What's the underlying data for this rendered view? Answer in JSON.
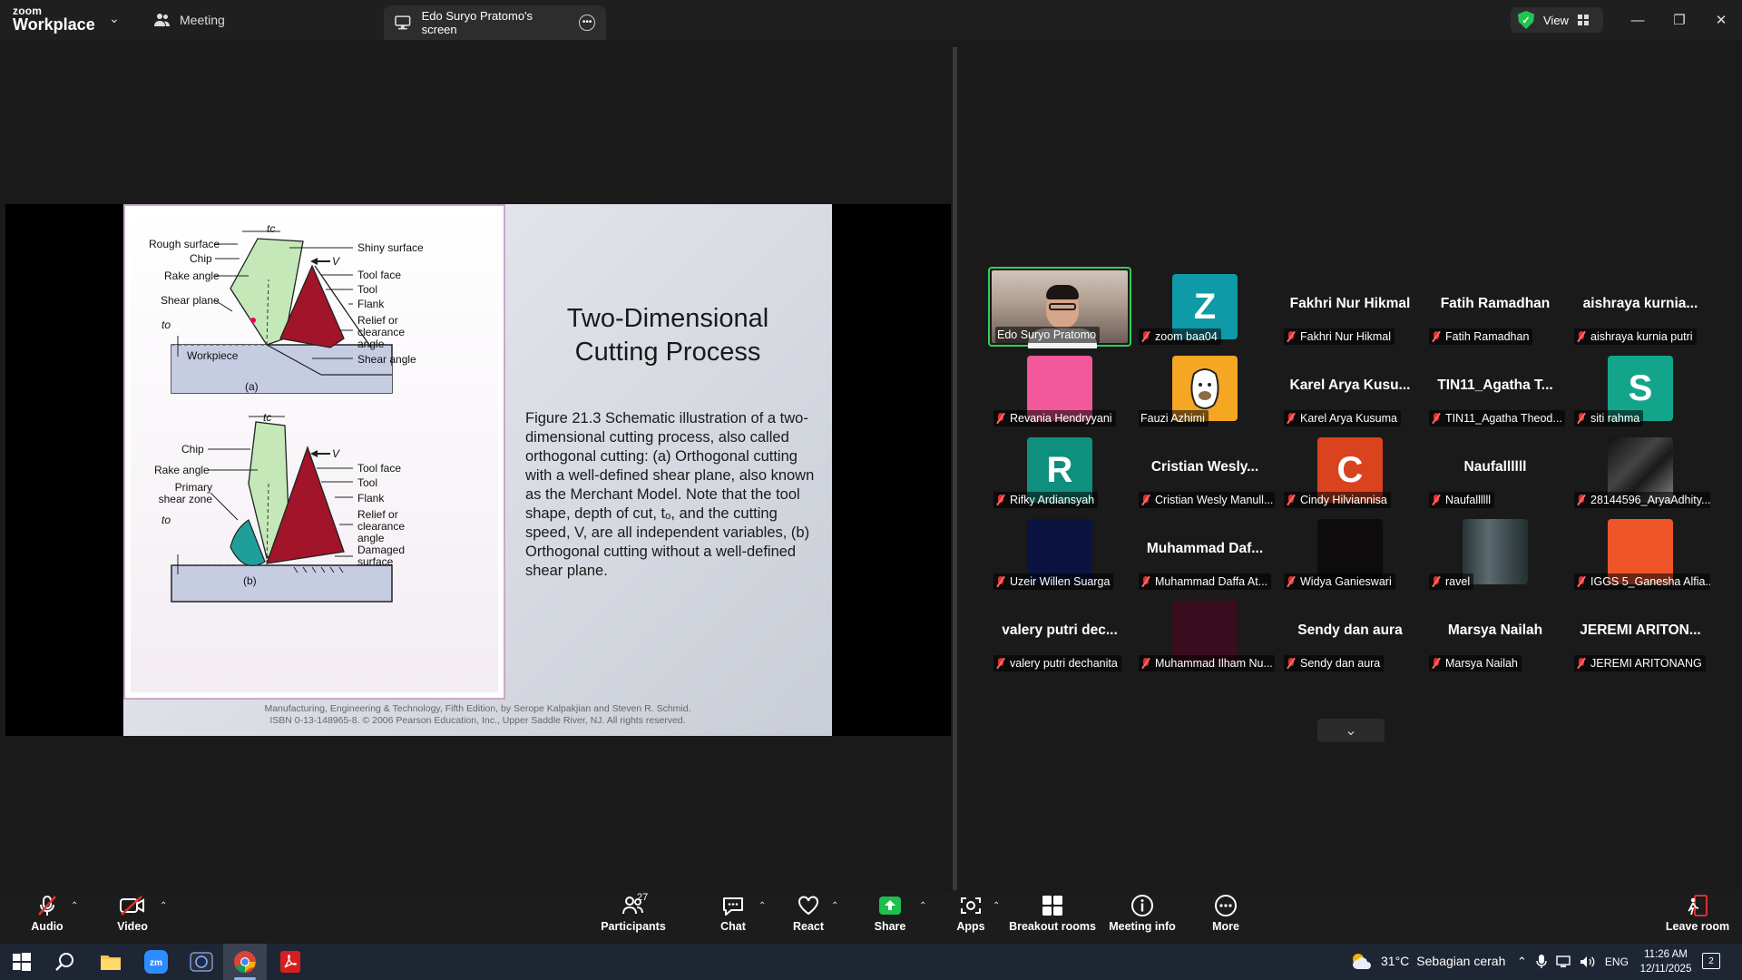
{
  "app": {
    "logo_top": "zoom",
    "logo_bottom": "Workplace",
    "meeting_tab": "Meeting",
    "screen_tab": "Edo Suryo Pratomo's screen",
    "view_label": "View"
  },
  "slide": {
    "title": "Two-Dimensional Cutting Process",
    "caption": "Figure 21.3  Schematic illustration of a two-dimensional cutting process, also called orthogonal cutting: (a) Orthogonal cutting with a well-defined shear plane, also known as the Merchant Model.  Note that the tool shape, depth of cut, tₒ, and the cutting speed, V, are all independent variables, (b)  Orthogonal cutting without a well-defined shear plane.",
    "credit_line1": "Manufacturing, Engineering & Technology, Fifth Edition, by Serope Kalpakjian and Steven R. Schmid.",
    "credit_line2": "ISBN 0-13-148965-8. © 2006 Pearson Education, Inc., Upper Saddle River, NJ.  All rights reserved.",
    "fig_a": {
      "top_dim": "tc",
      "left": [
        "Rough surface",
        "Chip",
        "Rake angle",
        "Shear plane"
      ],
      "right": [
        "Shiny surface",
        "Tool face",
        "Tool",
        "Flank",
        "Relief or clearance angle",
        "Shear angle"
      ],
      "velocity": "V",
      "depth": "to",
      "workpiece": "Workpiece",
      "caption": "(a)"
    },
    "fig_b": {
      "top_dim": "tc",
      "left": [
        "Chip",
        "Rake angle",
        "Primary shear zone"
      ],
      "right": [
        "Tool face",
        "Tool",
        "Flank",
        "Relief or clearance angle",
        "Damaged surface"
      ],
      "velocity": "V",
      "depth": "to",
      "caption": "(b)"
    }
  },
  "participants": [
    {
      "big": "",
      "name": "Edo Suryo Pratomo",
      "avatar": "",
      "color": "",
      "video": true,
      "active": true,
      "muted": false
    },
    {
      "big": "",
      "name": "zoom baa04",
      "avatar": "Z",
      "color": "#0e9aa7",
      "muted": true
    },
    {
      "big": "Fakhri Nur Hikmal",
      "name": "Fakhri Nur Hikmal",
      "avatar": "",
      "color": "",
      "muted": true
    },
    {
      "big": "Fatih Ramadhan",
      "name": "Fatih Ramadhan",
      "avatar": "",
      "color": "",
      "muted": true
    },
    {
      "big": "aishraya  kurnia...",
      "name": "aishraya kurnia putri",
      "avatar": "",
      "color": "",
      "muted": true
    },
    {
      "big": "",
      "name": "Revania Hendryyani",
      "avatar": "",
      "color": "#f2589a",
      "muted": true
    },
    {
      "big": "",
      "name": "Fauzi Azhimi",
      "avatar": "",
      "color": "#f5a623",
      "image": "drawing",
      "muted": false
    },
    {
      "big": "Karel Arya Kusu...",
      "name": "Karel Arya Kusuma",
      "avatar": "",
      "color": "",
      "muted": true
    },
    {
      "big": "TIN11_Agatha T...",
      "name": "TIN11_Agatha Theod...",
      "avatar": "",
      "color": "",
      "muted": true
    },
    {
      "big": "",
      "name": "siti rahma",
      "avatar": "S",
      "color": "#13a58c",
      "muted": true
    },
    {
      "big": "",
      "name": "Rifky Ardiansyah",
      "avatar": "R",
      "color": "#0f8f7e",
      "muted": true
    },
    {
      "big": "Cristian  Wesly...",
      "name": "Cristian Wesly Manull...",
      "avatar": "",
      "color": "",
      "muted": true
    },
    {
      "big": "",
      "name": "Cindy Hilviannisa",
      "avatar": "C",
      "color": "#d9431e",
      "muted": true
    },
    {
      "big": "Naufallllll",
      "name": "Naufallllll",
      "avatar": "",
      "color": "",
      "muted": true
    },
    {
      "big": "",
      "name": "28144596_AryaAdhity...",
      "avatar": "",
      "color": "#2a2a2a",
      "image": "photo",
      "muted": true
    },
    {
      "big": "",
      "name": "Uzeir Willen Suarga",
      "avatar": "",
      "color": "#0b1440",
      "muted": true
    },
    {
      "big": "Muhammad  Daf...",
      "name": "Muhammad Daffa At...",
      "avatar": "",
      "color": "",
      "muted": true
    },
    {
      "big": "",
      "name": "Widya Ganieswari",
      "avatar": "",
      "color": "#0d0b0c",
      "muted": true
    },
    {
      "big": "",
      "name": "ravel",
      "avatar": "",
      "color": "#3d4a4f",
      "image": "blur",
      "muted": true
    },
    {
      "big": "",
      "name": "IGGS 5_Ganesha Alfia...",
      "avatar": "",
      "color": "#f0552a",
      "muted": true
    },
    {
      "big": "valery  putri  dec...",
      "name": "valery putri dechanita",
      "avatar": "",
      "color": "",
      "muted": true
    },
    {
      "big": "",
      "name": "Muhammad Ilham Nu...",
      "avatar": "",
      "color": "#3a0d1e",
      "muted": true
    },
    {
      "big": "Sendy dan aura",
      "name": "Sendy dan aura",
      "avatar": "",
      "color": "",
      "muted": true
    },
    {
      "big": "Marsya Nailah",
      "name": "Marsya Nailah",
      "avatar": "",
      "color": "",
      "muted": true
    },
    {
      "big": "JEREMI  ARITON...",
      "name": "JEREMI ARITONANG",
      "avatar": "",
      "color": "",
      "muted": true
    }
  ],
  "toolbar": {
    "audio": "Audio",
    "video": "Video",
    "participants": "Participants",
    "participants_count": "27",
    "chat": "Chat",
    "react": "React",
    "share": "Share",
    "apps": "Apps",
    "breakout": "Breakout rooms",
    "meeting_info": "Meeting info",
    "more": "More",
    "leave": "Leave room"
  },
  "taskbar": {
    "weather_temp": "31°C",
    "weather_text": "Sebagian cerah",
    "lang": "ENG",
    "time": "11:26 AM",
    "date": "12/11/2025",
    "notifications": "2"
  },
  "colors": {
    "accent_green": "#23c552",
    "share_green": "#1fbf4f",
    "leave_red": "#e02f2f",
    "tool_red": "#a1142a",
    "chip_green": "#c5e8b8",
    "workpiece_blue": "#c6cde3"
  }
}
